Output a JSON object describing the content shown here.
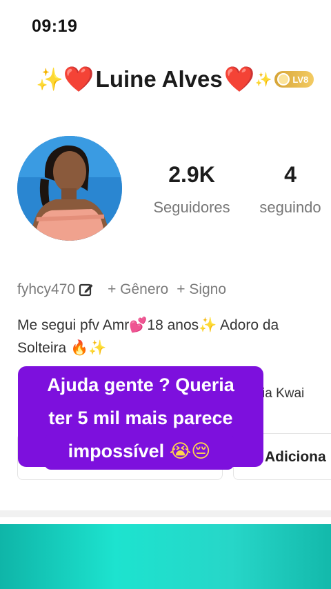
{
  "status_bar": {
    "time": "09:19"
  },
  "profile": {
    "name": "Luine Alves",
    "name_prefix_emoji": "✨",
    "heart_emoji": "❤️",
    "name_suffix_emoji": "✨",
    "level": "LV8",
    "level_color": "#E0AF45"
  },
  "stats": {
    "followers": {
      "value": "2.9K",
      "label": "Seguidores"
    },
    "following": {
      "value": "4",
      "label": "seguindo"
    }
  },
  "meta": {
    "username": "fyhcy470",
    "edit_icon": "edit-icon",
    "gender_tag": "+ Gênero",
    "sign_tag": "+ Signo"
  },
  "bio": {
    "line1_a": "Me segui pfv Amr",
    "line1_emoji1": "💕",
    "line1_b": "18 anos",
    "line1_emoji2": "✨",
    "line1_c": " Adoro da",
    "line2_a": "Solteira ",
    "line2_emoji1": "🔥",
    "line2_emoji2": "✨"
  },
  "link_text": "ia Kwai",
  "buttons": {
    "add_label": "Adiciona"
  },
  "caption": {
    "line1": "Ajuda gente ? Queria",
    "line2": "ter 5 mil mais parece",
    "line3": "impossível ",
    "line3_emoji": "😭😔",
    "background_color": "#7D10DD"
  },
  "colors": {
    "banner": "#1DE3CF"
  }
}
